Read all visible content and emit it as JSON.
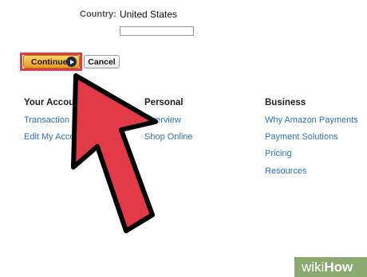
{
  "form": {
    "country_label": "Country:",
    "country_value": "United States",
    "blank_field_value": ""
  },
  "buttons": {
    "continue_label": "Continue",
    "cancel_label": "Cancel"
  },
  "footer": {
    "columns": [
      {
        "heading": "Your Accou",
        "links": [
          "Transaction",
          "Edit My Acco"
        ]
      },
      {
        "heading": "Personal",
        "links": [
          "Overview",
          "Shop Online"
        ]
      },
      {
        "heading": "Business",
        "links": [
          "Why Amazon Payments",
          "Payment Solutions",
          "Pricing",
          "Resources"
        ]
      }
    ]
  },
  "overlay": {
    "arrow_color": "#e23b47",
    "highlight_color": "#e23b47"
  },
  "watermark": {
    "prefix": "wiki",
    "suffix": "How"
  },
  "colors": {
    "link": "#2e73b8",
    "continue_button": "#f5b23a",
    "watermark_bg": "#8aaa70"
  }
}
